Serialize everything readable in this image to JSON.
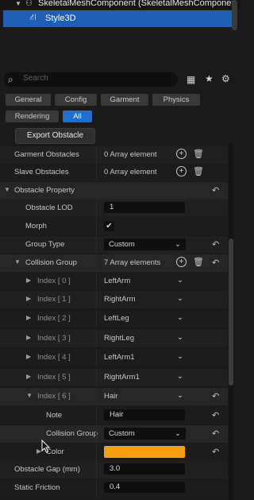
{
  "tree": {
    "component_label": "SkeletalMeshComponent (SkeletalMeshComponen",
    "selected_label": "Style3D"
  },
  "search": {
    "placeholder": "Search"
  },
  "filters": [
    {
      "label": "General"
    },
    {
      "label": "Config"
    },
    {
      "label": "Garment"
    },
    {
      "label": "Physics"
    },
    {
      "label": "Rendering"
    },
    {
      "label": "All"
    }
  ],
  "export_button": "Export Obstacle",
  "rows": {
    "garment_obstacles": {
      "label": "Garment Obstacles",
      "value": "0 Array element"
    },
    "slave_obstacles": {
      "label": "Slave Obstacles",
      "value": "0 Array element"
    },
    "obstacle_property": {
      "label": "Obstacle Property"
    },
    "obstacle_lod": {
      "label": "Obstacle LOD",
      "value": "1"
    },
    "morph": {
      "label": "Morph",
      "checked": true,
      "check_glyph": "✔"
    },
    "group_type": {
      "label": "Group Type",
      "value": "Custom"
    },
    "collision_group": {
      "label": "Collision Group",
      "value": "7 Array elements"
    },
    "indices": [
      {
        "label": "Index [ 0 ]",
        "value": "LeftArm"
      },
      {
        "label": "Index [ 1 ]",
        "value": "RightArm"
      },
      {
        "label": "Index [ 2 ]",
        "value": "LeftLeg"
      },
      {
        "label": "Index [ 3 ]",
        "value": "RightLeg"
      },
      {
        "label": "Index [ 4 ]",
        "value": "LeftArm1"
      },
      {
        "label": "Index [ 5 ]",
        "value": "RightArm1"
      },
      {
        "label": "Index [ 6 ]",
        "value": "Hair"
      }
    ],
    "note": {
      "label": "Note",
      "value": "Hair"
    },
    "collision_group_sub": {
      "label": "Collision Group",
      "value": "Custom"
    },
    "color": {
      "label": "Color",
      "color": "#f7a00f"
    },
    "obstacle_gap": {
      "label": "Obstacle Gap (mm)",
      "value": "3.0"
    },
    "static_friction": {
      "label": "Static Friction",
      "value": "0.4"
    }
  },
  "colors": {
    "accent": "#1d6fd1",
    "swatch": "#f7a00f",
    "background": "#1a1a1a"
  }
}
